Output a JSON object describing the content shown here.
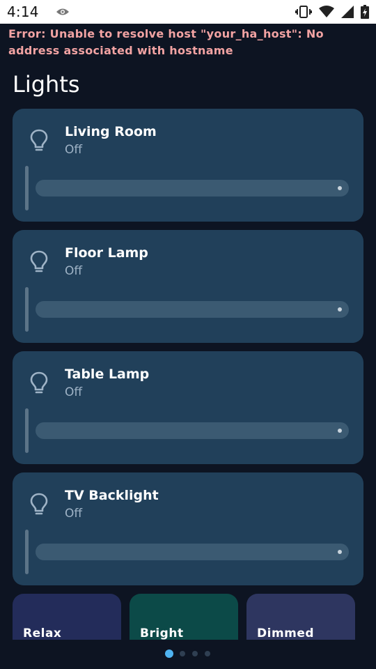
{
  "status_bar": {
    "time": "4:14",
    "left_icons": [
      "eye-icon"
    ],
    "right_icons": [
      "vibrate-icon",
      "wifi-icon",
      "signal-icon",
      "battery-icon"
    ]
  },
  "error": {
    "text": "Error: Unable to resolve host \"your_ha_host\": No address associated with hostname",
    "color": "#f2a3a3"
  },
  "section": {
    "title": "Lights"
  },
  "lights": [
    {
      "name": "Living Room",
      "state": "Off",
      "icon": "bulb-icon"
    },
    {
      "name": "Floor Lamp",
      "state": "Off",
      "icon": "bulb-icon"
    },
    {
      "name": "Table Lamp",
      "state": "Off",
      "icon": "bulb-icon"
    },
    {
      "name": "TV Backlight",
      "state": "Off",
      "icon": "bulb-icon"
    }
  ],
  "scenes": [
    {
      "label": "Relax",
      "color": "#232c5a"
    },
    {
      "label": "Bright",
      "color": "#0c4a48"
    },
    {
      "label": "Dimmed",
      "color": "#2e3660"
    }
  ],
  "pagination": {
    "pages": 4,
    "current": 1,
    "active_color": "#4fb3f0",
    "inactive_color": "#2f3f52"
  },
  "colors": {
    "background": "#0d1422",
    "card": "#21405a",
    "slider": "#3b5a72"
  }
}
